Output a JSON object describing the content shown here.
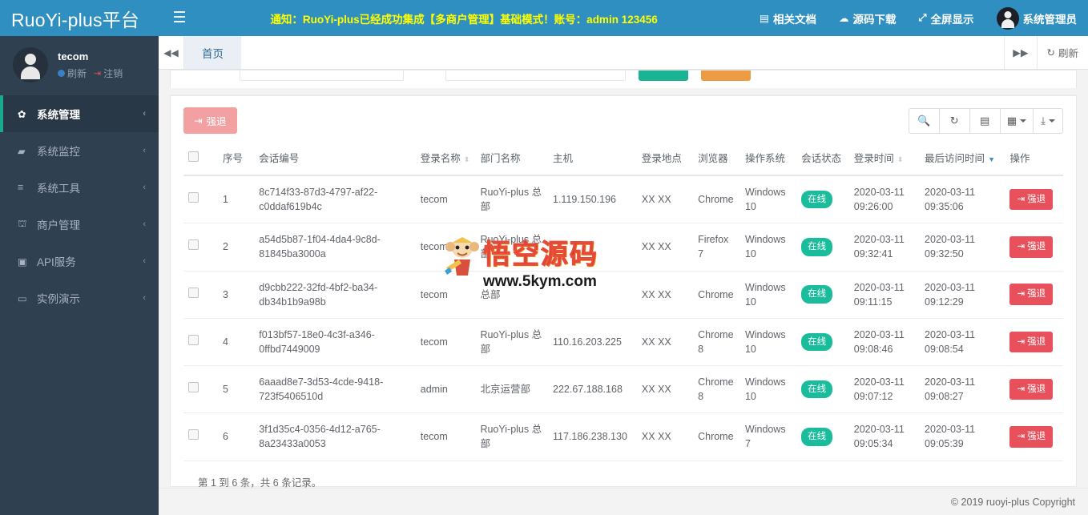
{
  "brand": {
    "title": "RuoYi-plus平台"
  },
  "profile": {
    "name": "tecom",
    "refresh_label": "刷新",
    "logout_label": "注销"
  },
  "sidebar": {
    "items": [
      {
        "label": "系统管理",
        "icon": "gear-icon",
        "glyph": "✿",
        "active": true
      },
      {
        "label": "系统监控",
        "icon": "video-camera-icon",
        "glyph": "▰",
        "active": false
      },
      {
        "label": "系统工具",
        "icon": "bars-icon",
        "glyph": "≡",
        "active": false
      },
      {
        "label": "商户管理",
        "icon": "bank-icon",
        "glyph": "⛫",
        "active": false
      },
      {
        "label": "API服务",
        "icon": "code-icon",
        "glyph": "⌨",
        "active": false
      },
      {
        "label": "实例演示",
        "icon": "desktop-icon",
        "glyph": "🖥",
        "active": false
      }
    ]
  },
  "topbar": {
    "menu_toggle": "☰",
    "notice": "通知：RuoYi-plus已经成功集成【多商户管理】基础模式！账号：admin 123456",
    "links": [
      {
        "label": "相关文档",
        "icon": "doc-icon",
        "glyph": "▤"
      },
      {
        "label": "源码下载",
        "icon": "cloud-download-icon",
        "glyph": "☁"
      },
      {
        "label": "全屏显示",
        "icon": "fullscreen-icon",
        "glyph": "⤢"
      }
    ],
    "user_label": "系统管理员"
  },
  "tabbar": {
    "prev_icon": "◀◀",
    "next_icon": "▶▶",
    "tabs": [
      {
        "label": "首页",
        "active": true
      }
    ],
    "refresh_label": "刷新",
    "refresh_icon": "↻"
  },
  "toolbar": {
    "force_logout_label": "强退",
    "force_logout_icon": "⇥",
    "buttons": [
      {
        "name": "search-icon",
        "glyph": "🔍",
        "caret": false
      },
      {
        "name": "refresh-icon",
        "glyph": "↻",
        "caret": false
      },
      {
        "name": "list-view-icon",
        "glyph": "▤",
        "caret": false
      },
      {
        "name": "columns-icon",
        "glyph": "▦",
        "caret": true
      },
      {
        "name": "export-icon",
        "glyph": "⤓",
        "caret": true
      }
    ]
  },
  "table": {
    "headers": [
      {
        "label": "序号",
        "sort": "none"
      },
      {
        "label": "会话编号",
        "sort": "none"
      },
      {
        "label": "登录名称",
        "sort": "both"
      },
      {
        "label": "部门名称",
        "sort": "none"
      },
      {
        "label": "主机",
        "sort": "none"
      },
      {
        "label": "登录地点",
        "sort": "none"
      },
      {
        "label": "浏览器",
        "sort": "none"
      },
      {
        "label": "操作系统",
        "sort": "none"
      },
      {
        "label": "会话状态",
        "sort": "none"
      },
      {
        "label": "登录时间",
        "sort": "both"
      },
      {
        "label": "最后访问时间",
        "sort": "desc"
      },
      {
        "label": "操作",
        "sort": "none"
      }
    ],
    "rows": [
      {
        "no": "1",
        "session_id": "8c714f33-87d3-4797-af22-c0ddaf619b4c",
        "login_name": "tecom",
        "dept": "RuoYi-plus 总部",
        "host": "1.119.150.196",
        "location": "XX XX",
        "browser": "Chrome",
        "os": "Windows 10",
        "status": "在线",
        "login_time": "2020-03-11 09:26:00",
        "last_access_time": "2020-03-11 09:35:06",
        "action": "强退"
      },
      {
        "no": "2",
        "session_id": "a54d5b87-1f04-4da4-9c8d-81845ba3000a",
        "login_name": "tecom",
        "dept": "RuoYi-plus 总部",
        "host": "",
        "location": "XX XX",
        "browser": "Firefox 7",
        "os": "Windows 10",
        "status": "在线",
        "login_time": "2020-03-11 09:32:41",
        "last_access_time": "2020-03-11 09:32:50",
        "action": "强退"
      },
      {
        "no": "3",
        "session_id": "d9cbb222-32fd-4bf2-ba34-db34b1b9a98b",
        "login_name": "tecom",
        "dept": "总部",
        "host": "",
        "location": "XX XX",
        "browser": "Chrome",
        "os": "Windows 10",
        "status": "在线",
        "login_time": "2020-03-11 09:11:15",
        "last_access_time": "2020-03-11 09:12:29",
        "action": "强退"
      },
      {
        "no": "4",
        "session_id": "f013bf57-18e0-4c3f-a346-0ffbd7449009",
        "login_name": "tecom",
        "dept": "RuoYi-plus 总部",
        "host": "110.16.203.225",
        "location": "XX XX",
        "browser": "Chrome 8",
        "os": "Windows 10",
        "status": "在线",
        "login_time": "2020-03-11 09:08:46",
        "last_access_time": "2020-03-11 09:08:54",
        "action": "强退"
      },
      {
        "no": "5",
        "session_id": "6aaad8e7-3d53-4cde-9418-723f5406510d",
        "login_name": "admin",
        "dept": "北京运营部",
        "host": "222.67.188.168",
        "location": "XX XX",
        "browser": "Chrome 8",
        "os": "Windows 10",
        "status": "在线",
        "login_time": "2020-03-11 09:07:12",
        "last_access_time": "2020-03-11 09:08:27",
        "action": "强退"
      },
      {
        "no": "6",
        "session_id": "3f1d35c4-0356-4d12-a765-8a23433a0053",
        "login_name": "tecom",
        "dept": "RuoYi-plus 总部",
        "host": "117.186.238.130",
        "location": "XX XX",
        "browser": "Chrome",
        "os": "Windows 7",
        "status": "在线",
        "login_time": "2020-03-11 09:05:34",
        "last_access_time": "2020-03-11 09:05:39",
        "action": "强退"
      }
    ],
    "pager_info": "第 1 到 6 条，共 6 条记录。"
  },
  "watermark": {
    "text": "悟空源码",
    "url": "www.5kym.com"
  },
  "footer": {
    "copyright": "© 2019 ruoyi-plus Copyright"
  },
  "colors": {
    "header_blue": "#2e8fc0",
    "sidebar_dark": "#2f4050",
    "notice_yellow": "#ffff00",
    "online_green": "#1bbc9b",
    "kick_red": "#e8505b",
    "kick_soft": "#f3a0a3",
    "search_green": "#1ab394",
    "search_orange": "#ed9c43"
  }
}
